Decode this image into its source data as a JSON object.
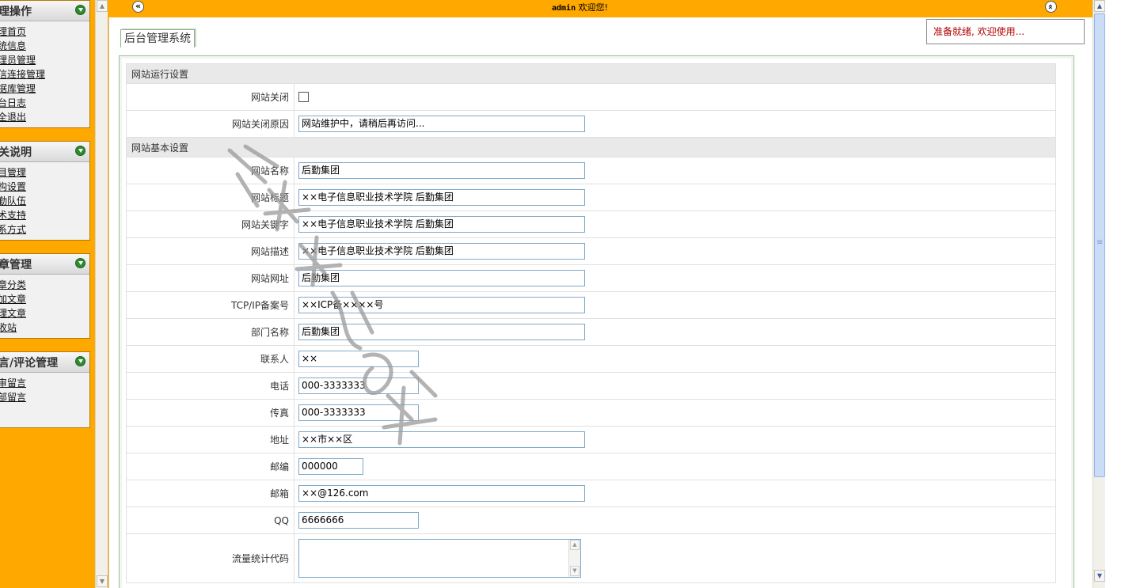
{
  "menu": [
    {
      "title": "理操作",
      "items": [
        "理首页",
        "统信息",
        "理员管理",
        "信连接管理",
        "据库管理",
        "台日志",
        "全退出"
      ]
    },
    {
      "title": "关说明",
      "items": [
        "目管理",
        "构设置",
        "勤队伍",
        "术支持",
        "系方式"
      ]
    },
    {
      "title": "章管理",
      "items": [
        "章分类",
        "加文章",
        "理文章",
        "收站"
      ]
    },
    {
      "title": "言/评论管理",
      "items": [
        "审留言",
        "部留言"
      ]
    }
  ],
  "topbar": {
    "user": "admin",
    "welcome": " 欢迎您!",
    "left_button": "«",
    "right_button": "»"
  },
  "tab": {
    "label": "后台管理系统"
  },
  "status": {
    "text": "准备就绪, 欢迎使用..."
  },
  "form": {
    "section_run": "网站运行设置",
    "section_basic": "网站基本设置",
    "site_closed_label": "网站关闭",
    "close_reason_label": "网站关闭原因",
    "close_reason": "网站维护中，请稍后再访问...",
    "site_name_label": "网站名称",
    "site_name": "后勤集团",
    "site_title_label": "网站标题",
    "site_title": "××电子信息职业技术学院 后勤集团",
    "keywords_label": "网站关键字",
    "keywords": "××电子信息职业技术学院 后勤集团",
    "description_label": "网站描述",
    "description": "××电子信息职业技术学院 后勤集团",
    "site_url_label": "网站网址",
    "site_url": "后勤集团",
    "icp_label": "TCP/IP备案号",
    "icp": "××ICP备××××号",
    "department_label": "部门名称",
    "department": "后勤集团",
    "contact_label": "联系人",
    "contact": "××",
    "phone_label": "电话",
    "phone": "000-3333333",
    "fax_label": "传真",
    "fax": "000-3333333",
    "address_label": "地址",
    "address": "××市××区",
    "postcode_label": "邮编",
    "postcode": "000000",
    "email_label": "邮箱",
    "email": "××@126.com",
    "qq_label": "QQ",
    "qq": "6666666",
    "stats_code_label": "流量统计代码"
  },
  "colors": {
    "frame": "#ffa800",
    "status_text": "#b00000",
    "section_bg": "#e9e9e9"
  }
}
